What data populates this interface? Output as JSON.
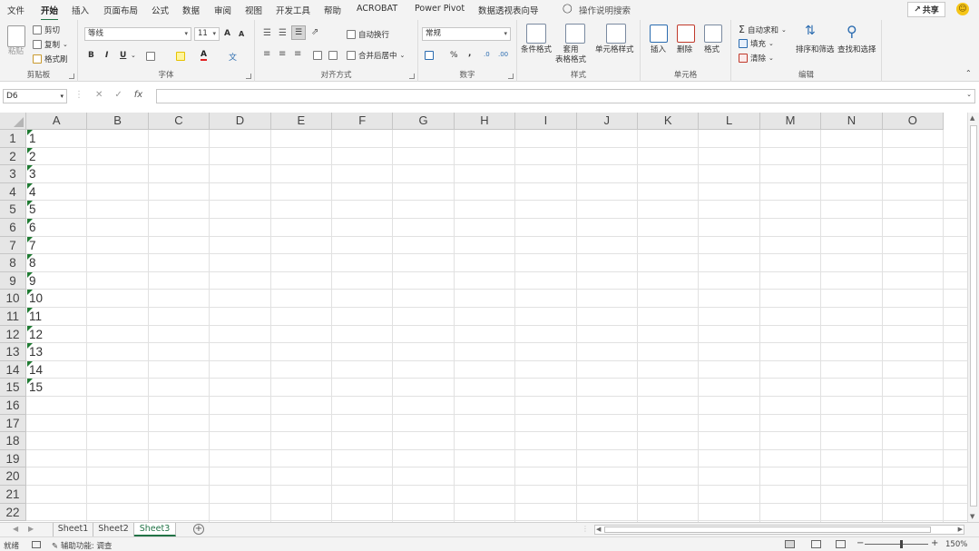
{
  "menu": {
    "items": [
      "文件",
      "开始",
      "插入",
      "页面布局",
      "公式",
      "数据",
      "审阅",
      "视图",
      "开发工具",
      "帮助",
      "ACROBAT",
      "Power Pivot",
      "数据透视表向导"
    ],
    "active": "开始",
    "search": "操作说明搜索",
    "share": "共享"
  },
  "ribbon": {
    "clipboard": {
      "label": "剪贴板",
      "paste": "粘贴",
      "cut": "剪切",
      "copy": "复制",
      "painter": "格式刷"
    },
    "font": {
      "label": "字体",
      "font_name": "等线",
      "font_size": "11",
      "bold": "B",
      "italic": "I",
      "underline": "U",
      "grow": "A",
      "shrink": "A",
      "font_color": "A",
      "phonetic": "文"
    },
    "alignment": {
      "label": "对齐方式",
      "wrap": "自动换行",
      "merge": "合并后居中"
    },
    "number": {
      "label": "数字",
      "format": "常规",
      "percent": "%",
      "comma": ","
    },
    "styles": {
      "label": "样式",
      "conditional": "条件格式",
      "table": "套用\n表格格式",
      "cell_styles": "单元格样式"
    },
    "cells": {
      "label": "单元格",
      "insert": "插入",
      "delete": "删除",
      "format": "格式"
    },
    "editing": {
      "label": "编辑",
      "autosum": "自动求和",
      "fill": "填充",
      "clear": "清除",
      "sort": "排序和筛选",
      "find": "查找和选择"
    }
  },
  "formula_bar": {
    "name_box": "D6",
    "cancel": "✕",
    "enter": "✓",
    "fx": "fx",
    "value": ""
  },
  "columns": [
    "A",
    "B",
    "C",
    "D",
    "E",
    "F",
    "G",
    "H",
    "I",
    "J",
    "K",
    "L",
    "M",
    "N",
    "O"
  ],
  "rows": [
    "1",
    "2",
    "3",
    "4",
    "5",
    "6",
    "7",
    "8",
    "9",
    "10",
    "11",
    "12",
    "13",
    "14",
    "15",
    "16",
    "17",
    "18",
    "19",
    "20",
    "21",
    "22"
  ],
  "column_a_values": [
    "1",
    "2",
    "3",
    "4",
    "5",
    "6",
    "7",
    "8",
    "9",
    "10",
    "11",
    "12",
    "13",
    "14",
    "15"
  ],
  "sheets": [
    "Sheet1",
    "Sheet2",
    "Sheet3"
  ],
  "active_sheet": "Sheet3",
  "status": {
    "ready": "就绪",
    "accessibility": "辅助功能: 调查",
    "zoom": "150%"
  },
  "colors": {
    "accent": "#217346",
    "text_marker": "#1f7a32"
  }
}
